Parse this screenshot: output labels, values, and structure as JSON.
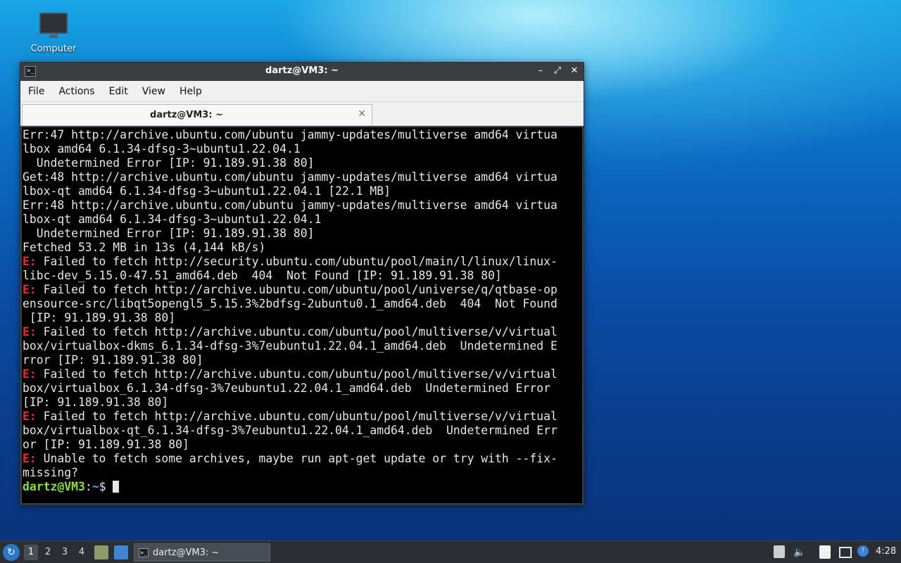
{
  "desktop": {
    "icon_label": "Computer",
    "icon_name": "computer-icon"
  },
  "window": {
    "title": "dartz@VM3: ~",
    "buttons": {
      "minimize": "–",
      "maximize": "⤢",
      "close": "✕"
    }
  },
  "menu": {
    "items": [
      "File",
      "Actions",
      "Edit",
      "View",
      "Help"
    ]
  },
  "tab": {
    "label": "dartz@VM3: ~",
    "close": "✕"
  },
  "terminal": {
    "colors": {
      "background": "#000000",
      "text": "#e6e6e6",
      "error": "#ef2929",
      "user": "#8ae234",
      "path": "#729fcf"
    },
    "lines": [
      {
        "text": "Err:47 http://archive.ubuntu.com/ubuntu jammy-updates/multiverse amd64 virtua"
      },
      {
        "text": "lbox amd64 6.1.34-dfsg-3~ubuntu1.22.04.1"
      },
      {
        "text": "  Undetermined Error [IP: 91.189.91.38 80]"
      },
      {
        "text": "Get:48 http://archive.ubuntu.com/ubuntu jammy-updates/multiverse amd64 virtua"
      },
      {
        "text": "lbox-qt amd64 6.1.34-dfsg-3~ubuntu1.22.04.1 [22.1 MB]"
      },
      {
        "text": "Err:48 http://archive.ubuntu.com/ubuntu jammy-updates/multiverse amd64 virtua"
      },
      {
        "text": "lbox-qt amd64 6.1.34-dfsg-3~ubuntu1.22.04.1"
      },
      {
        "text": "  Undetermined Error [IP: 91.189.91.38 80]"
      },
      {
        "text": "Fetched 53.2 MB in 13s (4,144 kB/s)"
      },
      {
        "err": "E:",
        "text": " Failed to fetch http://security.ubuntu.com/ubuntu/pool/main/l/linux/linux-"
      },
      {
        "text": "libc-dev_5.15.0-47.51_amd64.deb  404  Not Found [IP: 91.189.91.38 80]"
      },
      {
        "err": "E:",
        "text": " Failed to fetch http://archive.ubuntu.com/ubuntu/pool/universe/q/qtbase-op"
      },
      {
        "text": "ensource-src/libqt5opengl5_5.15.3%2bdfsg-2ubuntu0.1_amd64.deb  404  Not Found"
      },
      {
        "text": " [IP: 91.189.91.38 80]"
      },
      {
        "err": "E:",
        "text": " Failed to fetch http://archive.ubuntu.com/ubuntu/pool/multiverse/v/virtual"
      },
      {
        "text": "box/virtualbox-dkms_6.1.34-dfsg-3%7eubuntu1.22.04.1_amd64.deb  Undetermined E"
      },
      {
        "text": "rror [IP: 91.189.91.38 80]"
      },
      {
        "err": "E:",
        "text": " Failed to fetch http://archive.ubuntu.com/ubuntu/pool/multiverse/v/virtual"
      },
      {
        "text": "box/virtualbox_6.1.34-dfsg-3%7eubuntu1.22.04.1_amd64.deb  Undetermined Error"
      },
      {
        "text": "[IP: 91.189.91.38 80]"
      },
      {
        "err": "E:",
        "text": " Failed to fetch http://archive.ubuntu.com/ubuntu/pool/multiverse/v/virtual"
      },
      {
        "text": "box/virtualbox-qt_6.1.34-dfsg-3%7eubuntu1.22.04.1_amd64.deb  Undetermined Err"
      },
      {
        "text": "or [IP: 91.189.91.38 80]"
      },
      {
        "err": "E:",
        "text": " Unable to fetch some archives, maybe run apt-get update or try with --fix-"
      },
      {
        "text": "missing?"
      }
    ],
    "prompt": {
      "user": "dartz@VM3",
      "sep": ":",
      "path": "~",
      "symbol": "$ "
    }
  },
  "taskbar": {
    "start_icon": "lubuntu-start-icon",
    "start_glyph": "↻",
    "workspaces": [
      "1",
      "2",
      "3",
      "4"
    ],
    "active_workspace": "1",
    "task_label": "dartz@VM3: ~",
    "task_icon_glyph": ">_",
    "volume_glyph": "🔈",
    "notify_glyph": "!",
    "clock": "4:28"
  }
}
